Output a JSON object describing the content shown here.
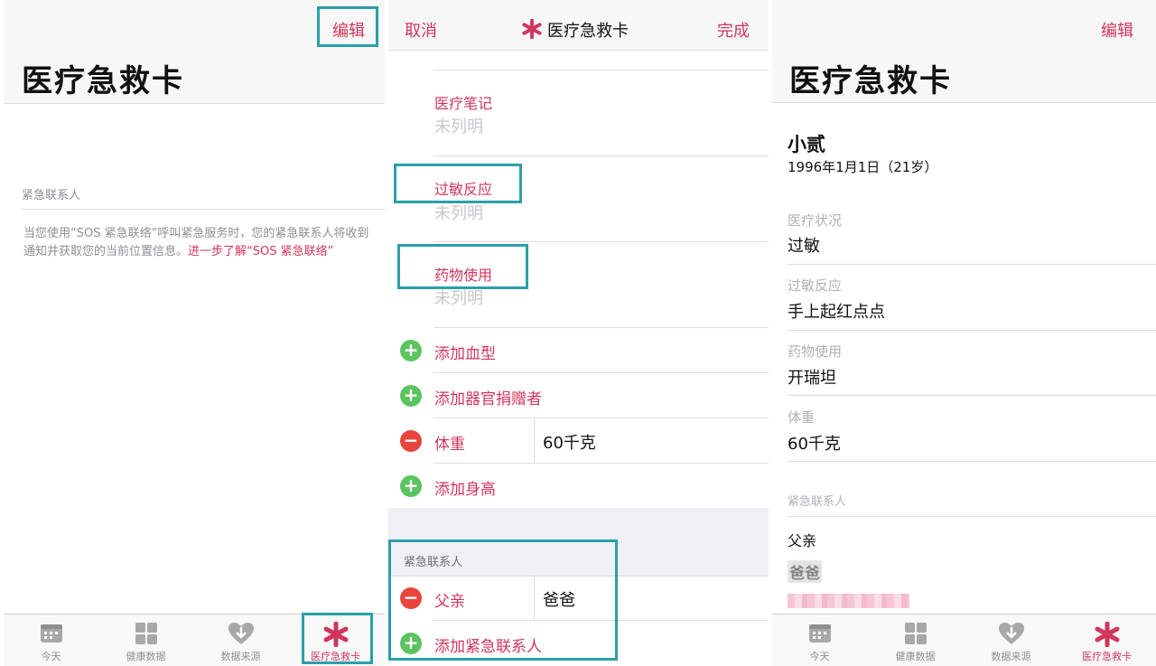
{
  "panel1": {
    "edit": "编辑",
    "title": "医疗急救卡",
    "section_label": "紧急联系人",
    "desc_text": "当您使用“SOS 紧急联络”呼叫紧急服务时，您的紧急联系人将收到通知并获取您的当前位置信息。",
    "desc_link": "进一步了解“SOS 紧急联络”"
  },
  "panel2": {
    "cancel": "取消",
    "title": "医疗急救卡",
    "done": "完成",
    "notes_label": "医疗笔记",
    "notes_value": "未列明",
    "allergy_label": "过敏反应",
    "allergy_value": "未列明",
    "meds_label": "药物使用",
    "meds_value": "未列明",
    "add_blood": "添加血型",
    "add_donor": "添加器官捐赠者",
    "weight_label": "体重",
    "weight_value": "60千克",
    "add_height": "添加身高",
    "contacts_section": "紧急联系人",
    "contact_relation": "父亲",
    "contact_name": "爸爸",
    "add_contact": "添加紧急联系人"
  },
  "panel3": {
    "edit": "编辑",
    "title": "医疗急救卡",
    "name": "小贰",
    "birth": "1996年1月1日（21岁）",
    "cond_label": "医疗状况",
    "cond_value": "过敏",
    "allergy_label": "过敏反应",
    "allergy_value": "手上起红点点",
    "meds_label": "药物使用",
    "meds_value": "开瑞坦",
    "weight_label": "体重",
    "weight_value": "60千克",
    "contacts_label": "紧急联系人",
    "contact_relation": "父亲",
    "contact_name": "爸爸"
  },
  "tabs": [
    "今天",
    "健康数据",
    "数据来源",
    "医疗急救卡"
  ],
  "colors": {
    "accent": "#d1365c",
    "highlight": "#2aa0a8",
    "add": "#5cc45e",
    "delete": "#e8453c"
  }
}
